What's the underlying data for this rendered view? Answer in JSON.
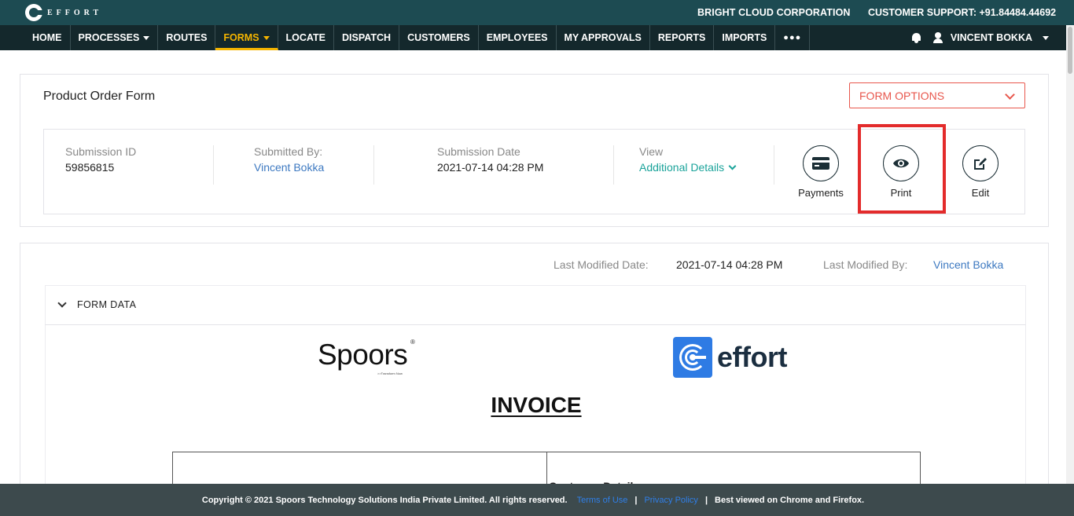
{
  "brand": {
    "name": "EFFORT"
  },
  "header": {
    "company": "BRIGHT CLOUD CORPORATION",
    "support": "CUSTOMER SUPPORT: +91.84484.44692"
  },
  "nav": {
    "items": [
      {
        "label": "HOME"
      },
      {
        "label": "PROCESSES"
      },
      {
        "label": "ROUTES"
      },
      {
        "label": "FORMS"
      },
      {
        "label": "LOCATE"
      },
      {
        "label": "DISPATCH"
      },
      {
        "label": "CUSTOMERS"
      },
      {
        "label": "EMPLOYEES"
      },
      {
        "label": "MY APPROVALS"
      },
      {
        "label": "REPORTS"
      },
      {
        "label": "IMPORTS"
      }
    ],
    "more": "●●●",
    "user": "VINCENT BOKKA"
  },
  "form": {
    "title": "Product Order Form",
    "options_label": "FORM OPTIONS",
    "submission_id_label": "Submission ID",
    "submission_id": "59856815",
    "submitted_by_label": "Submitted By:",
    "submitted_by": "Vincent Bokka",
    "submission_date_label": "Submission Date",
    "submission_date": "2021-07-14 04:28 PM",
    "view_label": "View",
    "view_value": "Additional Details",
    "actions": {
      "payments": "Payments",
      "print": "Print",
      "edit": "Edit"
    }
  },
  "modified": {
    "date_label": "Last Modified Date:",
    "date": "2021-07-14 04:28 PM",
    "by_label": "Last Modified By:",
    "by": "Vincent Bokka"
  },
  "form_data": {
    "label": "FORM DATA",
    "spoors_logo": "Spoors",
    "spoors_tagline": ">>Transform Now",
    "effort_logo": "effort",
    "invoice_title": "INVOICE",
    "customer_details": "Customer Details"
  },
  "footer": {
    "copyright": "Copyright © 2021 Spoors Technology Solutions India Private Limited. All rights reserved.",
    "terms": "Terms of Use",
    "sep": "|",
    "privacy": "Privacy Policy",
    "best_viewed": "Best viewed on Chrome and Firefox."
  },
  "colors": {
    "topbar": "#1d4b52",
    "navbar": "#14282c",
    "accent_active": "#f4b400",
    "form_options": "#e8574d",
    "link_blue": "#3d79c1",
    "teal": "#1aa39a",
    "highlight_red": "#e32b2b",
    "footer": "#3d4a4d"
  }
}
